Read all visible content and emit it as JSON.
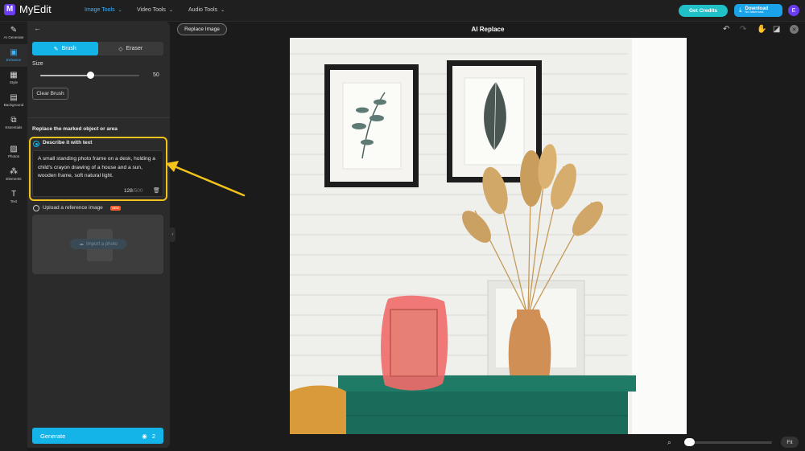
{
  "app": {
    "name": "MyEdit",
    "logo_letter": "M"
  },
  "topnav": [
    {
      "label": "Image Tools",
      "active": true
    },
    {
      "label": "Video Tools",
      "active": false
    },
    {
      "label": "Audio Tools",
      "active": false
    }
  ],
  "header": {
    "credits_label": "Get Credits",
    "download_label": "Download",
    "download_sub": "No Watermark",
    "avatar_initial": "E"
  },
  "rail": [
    {
      "label": "AI Generate",
      "icon": "magic-wand-icon",
      "glyph": "✎",
      "active": false
    },
    {
      "label": "Enhance",
      "icon": "enhance-icon",
      "glyph": "▣",
      "active": true
    },
    {
      "label": "Style",
      "icon": "style-icon",
      "glyph": "▦",
      "active": false
    },
    {
      "label": "Background",
      "icon": "background-icon",
      "glyph": "▤",
      "active": false
    },
    {
      "label": "Essentials",
      "icon": "essentials-icon",
      "glyph": "⧉",
      "active": false
    },
    {
      "label": "Photos",
      "icon": "photos-icon",
      "glyph": "▨",
      "active": false
    },
    {
      "label": "Elements",
      "icon": "elements-icon",
      "glyph": "⁂",
      "active": false
    },
    {
      "label": "Text",
      "icon": "text-icon",
      "glyph": "T",
      "active": false
    }
  ],
  "panel": {
    "brush_label": "Brush",
    "eraser_label": "Eraser",
    "size_label": "Size",
    "size_value": "50",
    "size_fraction": 0.5,
    "clear_label": "Clear Brush",
    "section_title": "Replace the marked object or area",
    "option1_label": "Describe it with text",
    "prompt_text": "A small standing photo frame on a desk, holding a child's crayon drawing of a house and a sun, wooden frame, soft natural light.",
    "char_count": "128",
    "char_max": "/500",
    "option2_label": "Upload a reference image",
    "new_badge": "NEW",
    "import_label": "Import a photo",
    "generate_label": "Generate",
    "generate_cost": "2"
  },
  "canvas": {
    "replace_label": "Replace Image",
    "title": "AI Replace",
    "fit_label": "Fit",
    "zoom_fraction": 0.05
  },
  "colors": {
    "accent": "#15b4e8",
    "highlight": "#f3c31b",
    "mask": "#f06a6a",
    "table": "#1f7a66"
  }
}
